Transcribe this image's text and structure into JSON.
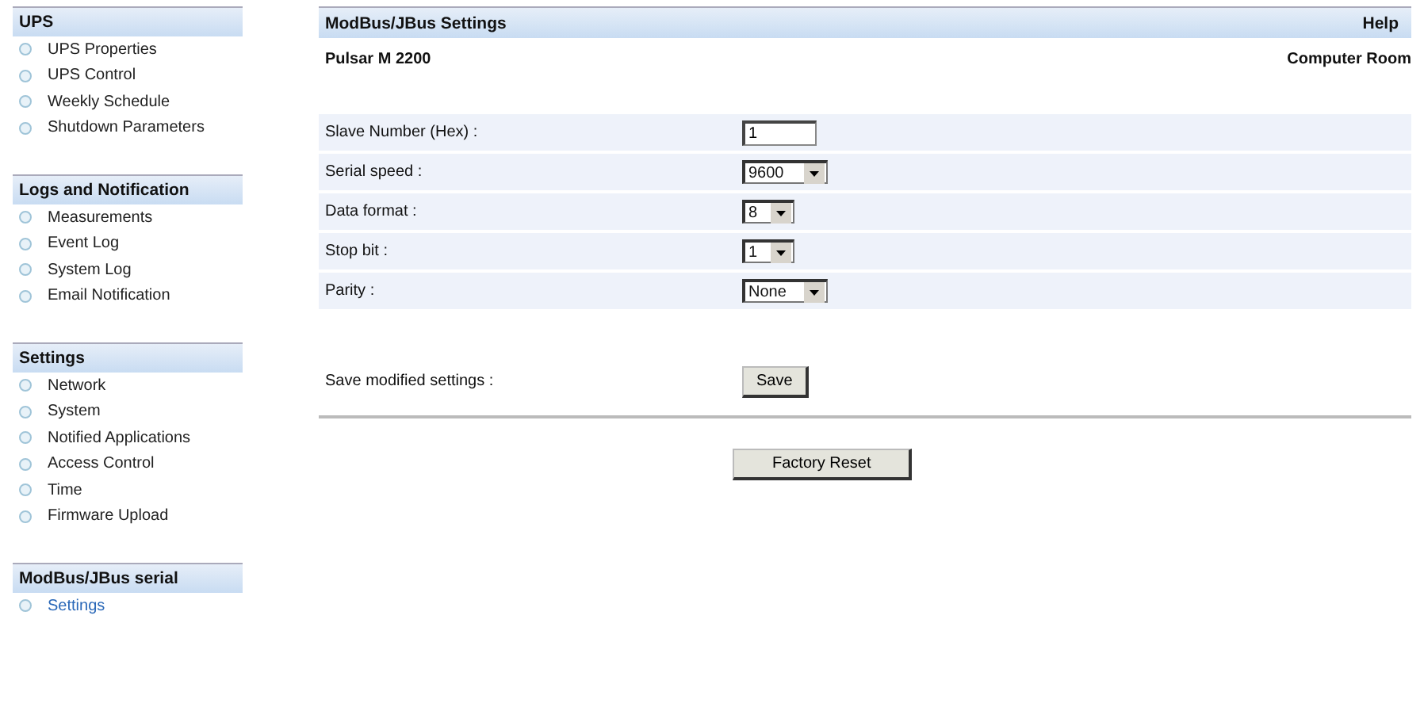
{
  "sidebar": {
    "sections": [
      {
        "title": "UPS",
        "items": [
          {
            "label": "UPS Properties",
            "selected": false
          },
          {
            "label": "UPS Control",
            "selected": false
          },
          {
            "label": "Weekly Schedule",
            "selected": false
          },
          {
            "label": "Shutdown Parameters",
            "selected": false
          }
        ]
      },
      {
        "title": "Logs and Notification",
        "items": [
          {
            "label": "Measurements",
            "selected": false
          },
          {
            "label": "Event Log",
            "selected": false
          },
          {
            "label": "System Log",
            "selected": false
          },
          {
            "label": "Email Notification",
            "selected": false
          }
        ]
      },
      {
        "title": "Settings",
        "items": [
          {
            "label": "Network",
            "selected": false
          },
          {
            "label": "System",
            "selected": false
          },
          {
            "label": "Notified Applications",
            "selected": false
          },
          {
            "label": "Access Control",
            "selected": false
          },
          {
            "label": "Time",
            "selected": false
          },
          {
            "label": "Firmware Upload",
            "selected": false
          }
        ]
      },
      {
        "title": "ModBus/JBus serial",
        "items": [
          {
            "label": "Settings",
            "selected": true
          }
        ]
      }
    ]
  },
  "header": {
    "title": "ModBus/JBus Settings",
    "help": "Help"
  },
  "device": {
    "model": "Pulsar M 2200",
    "location": "Computer Room"
  },
  "fields": [
    {
      "kind": "text",
      "label": "Slave Number (Hex) :",
      "value": "1"
    },
    {
      "kind": "select",
      "label": "Serial speed :",
      "value": "9600"
    },
    {
      "kind": "select",
      "label": "Data format :",
      "value": "8"
    },
    {
      "kind": "select",
      "label": "Stop bit :",
      "value": "1"
    },
    {
      "kind": "select",
      "label": "Parity :",
      "value": "None"
    }
  ],
  "save": {
    "label": "Save modified settings :",
    "button": "Save"
  },
  "factory_reset": "Factory Reset"
}
